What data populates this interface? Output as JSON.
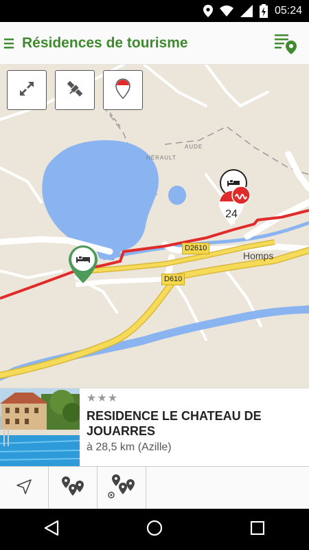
{
  "status_bar": {
    "time": "05:24",
    "icons": [
      "location-icon",
      "wifi-icon",
      "signal-icon",
      "battery-charging-icon"
    ]
  },
  "app_bar": {
    "title": "Résidences de tourisme",
    "menu_icon": "hamburger-menu-icon",
    "filter_icon": "filter-list-location-icon",
    "accent_color": "#3f8a2e"
  },
  "map": {
    "controls": [
      {
        "name": "fullscreen-button",
        "icon": "expand-arrows-icon"
      },
      {
        "name": "satellite-button",
        "icon": "satellite-icon"
      },
      {
        "name": "location-pin-button",
        "icon": "red-pin-icon"
      }
    ],
    "road_labels": [
      "D2610",
      "D610"
    ],
    "place_labels": [
      "Homps"
    ],
    "border_labels": [
      "HÉRAULT",
      "AUDE"
    ],
    "cluster_count": "24",
    "route_color": "#e02b2b",
    "marker_color": "#4e9a5b"
  },
  "card": {
    "stars": "★★★",
    "title": "Residence le Chateau de Jouarres",
    "distance": "à 28,5 km (Azille)"
  },
  "bottom_bar": {
    "buttons": [
      "navigate-icon",
      "multi-pin-icon",
      "nearby-pins-icon"
    ]
  },
  "nav_bar": {
    "buttons": [
      "back-icon",
      "home-icon",
      "recents-icon"
    ]
  }
}
